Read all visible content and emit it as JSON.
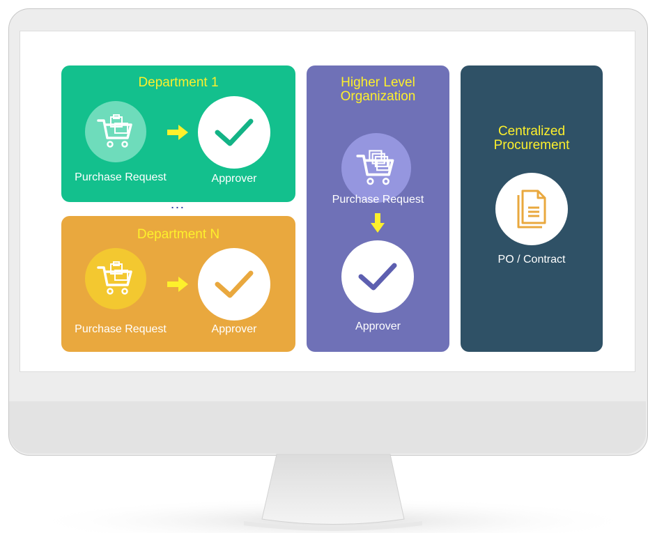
{
  "diagram": {
    "department_1": {
      "title": "Department 1",
      "request_label": "Purchase Request",
      "approver_label": "Approver",
      "color": "#13c08d"
    },
    "ellipsis": "...",
    "department_n": {
      "title": "Department N",
      "request_label": "Purchase Request",
      "approver_label": "Approver",
      "color": "#e9a83e"
    },
    "higher_level": {
      "title_line1": "Higher Level",
      "title_line2": "Organization",
      "request_label": "Purchase Request",
      "approver_label": "Approver",
      "color": "#6f71b7"
    },
    "centralized": {
      "title_line1": "Centralized",
      "title_line2": "Procurement",
      "document_label": "PO / Contract",
      "color": "#2f5166"
    },
    "accent_color": "#fdf02c",
    "icons": [
      "shopping-cart-icon",
      "arrow-right-icon",
      "checkmark-icon",
      "arrow-down-icon",
      "document-icon"
    ]
  }
}
